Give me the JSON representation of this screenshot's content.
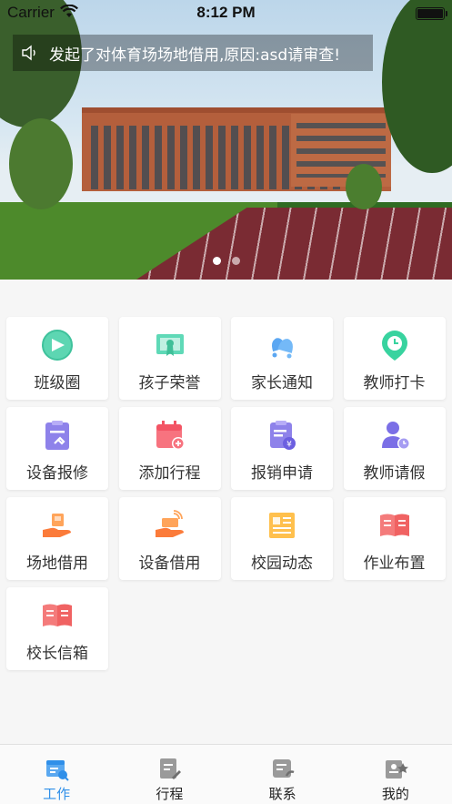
{
  "status_bar": {
    "carrier": "Carrier",
    "time": "8:12 PM"
  },
  "banner": {
    "notice_text": "发起了对体育场场地借用,原因:asd请审查!",
    "page_count": 2,
    "active_page": 1
  },
  "grid": [
    {
      "label": "班级圈",
      "icon": "class-circle-icon"
    },
    {
      "label": "孩子荣誉",
      "icon": "certificate-icon"
    },
    {
      "label": "家长通知",
      "icon": "bell-icon"
    },
    {
      "label": "教师打卡",
      "icon": "clock-pin-icon"
    },
    {
      "label": "设备报修",
      "icon": "repair-clipboard-icon"
    },
    {
      "label": "添加行程",
      "icon": "calendar-add-icon"
    },
    {
      "label": "报销申请",
      "icon": "reimburse-clipboard-icon"
    },
    {
      "label": "教师请假",
      "icon": "leave-person-icon"
    },
    {
      "label": "场地借用",
      "icon": "venue-hand-icon"
    },
    {
      "label": "设备借用",
      "icon": "device-hand-icon"
    },
    {
      "label": "校园动态",
      "icon": "newspaper-icon"
    },
    {
      "label": "作业布置",
      "icon": "book-icon"
    },
    {
      "label": "校长信箱",
      "icon": "mailbox-book-icon"
    }
  ],
  "tabs": [
    {
      "label": "工作",
      "icon": "work-icon",
      "active": true
    },
    {
      "label": "行程",
      "icon": "schedule-icon",
      "active": false
    },
    {
      "label": "联系",
      "icon": "contacts-icon",
      "active": false
    },
    {
      "label": "我的",
      "icon": "profile-icon",
      "active": false
    }
  ],
  "colors": {
    "accent": "#2f8fe9",
    "tile_bg": "#ffffff",
    "page_bg": "#f6f6f6"
  }
}
